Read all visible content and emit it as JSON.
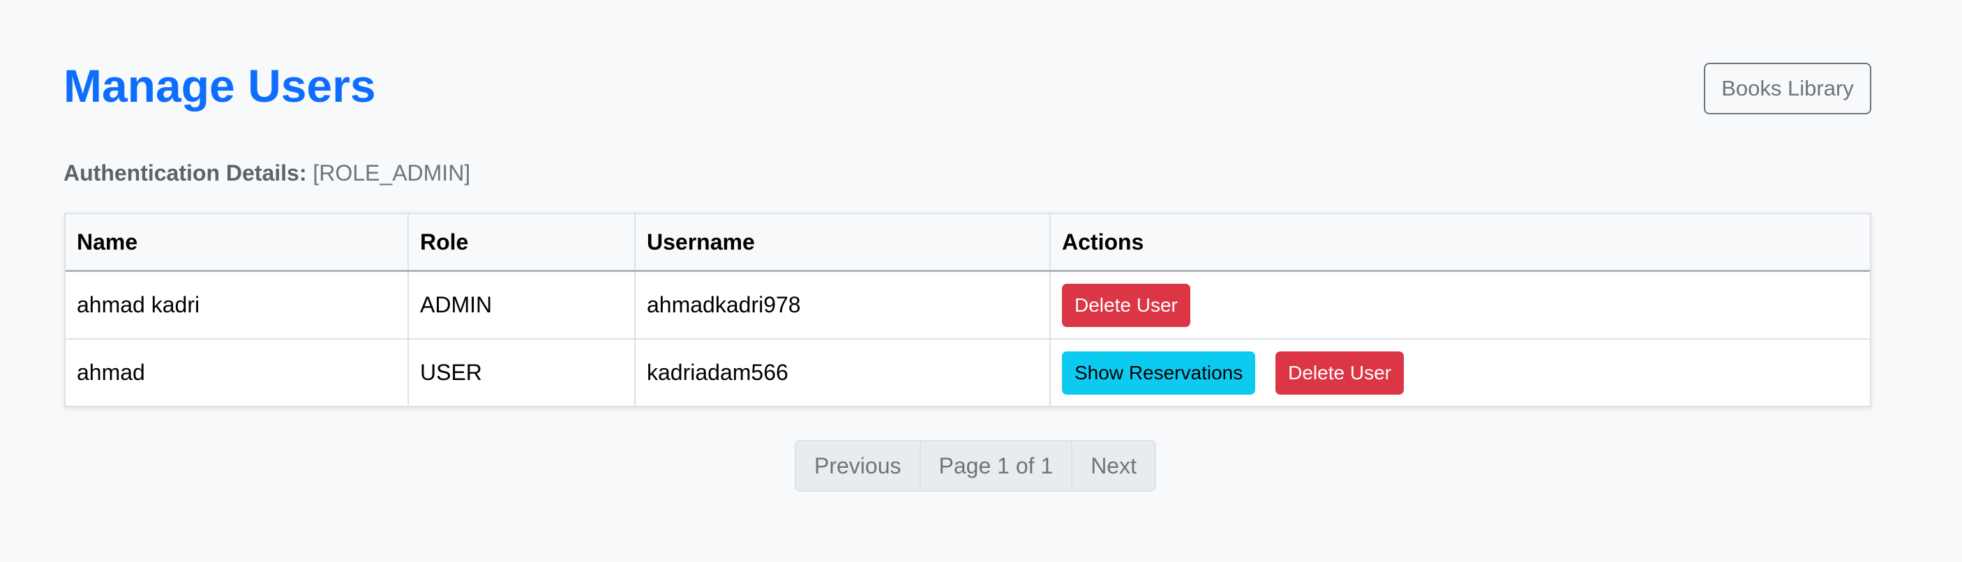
{
  "header": {
    "title": "Manage Users",
    "books_library_label": "Books Library"
  },
  "auth": {
    "label": "Authentication Details:",
    "value": "[ROLE_ADMIN]"
  },
  "table": {
    "columns": [
      "Name",
      "Role",
      "Username",
      "Actions"
    ],
    "rows": [
      {
        "name": "ahmad kadri",
        "role": "ADMIN",
        "username": "ahmadkadri978",
        "actions": [
          "Delete User"
        ]
      },
      {
        "name": "ahmad",
        "role": "USER",
        "username": "kadriadam566",
        "actions": [
          "Show Reservations",
          "Delete User"
        ]
      }
    ]
  },
  "pagination": {
    "previous_label": "Previous",
    "page_info": "Page 1 of 1",
    "next_label": "Next"
  },
  "colors": {
    "primary": "#0d6efd",
    "danger": "#dc3545",
    "info": "#0dcaf0",
    "secondary": "#6c757d",
    "background": "#f8f9fa"
  }
}
